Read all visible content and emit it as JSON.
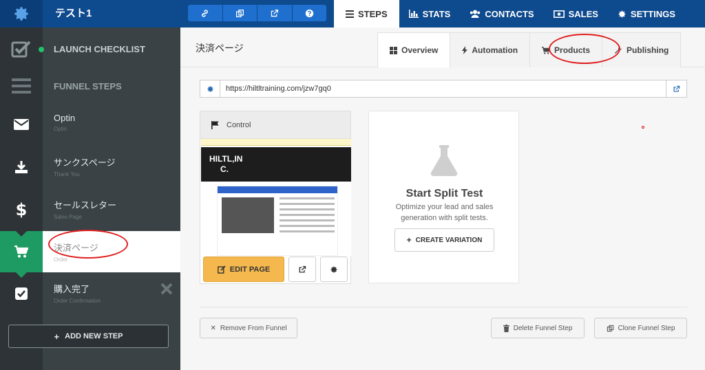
{
  "header": {
    "funnel_title": "テスト1",
    "nav": [
      {
        "label": "STEPS",
        "icon": "list-icon",
        "active": true
      },
      {
        "label": "STATS",
        "icon": "bar-chart-icon"
      },
      {
        "label": "CONTACTS",
        "icon": "users-icon"
      },
      {
        "label": "SALES",
        "icon": "money-icon"
      },
      {
        "label": "SETTINGS",
        "icon": "gear-icon"
      }
    ]
  },
  "sidebar": {
    "launch_checklist": "LAUNCH CHECKLIST",
    "funnel_steps_heading": "FUNNEL STEPS",
    "steps": [
      {
        "name": "Optin",
        "sub": "Optin",
        "icon": "envelope-icon"
      },
      {
        "name": "サンクスページ",
        "sub": "Thank You",
        "icon": "download-icon"
      },
      {
        "name": "セールスレター",
        "sub": "Sales Page",
        "icon": "dollar-icon"
      },
      {
        "name": "決済ページ",
        "sub": "Order",
        "icon": "cart-icon",
        "active": true
      },
      {
        "name": "購入完了",
        "sub": "Order Confirmation",
        "icon": "checkbox-icon"
      }
    ],
    "add_new_step": "ADD NEW STEP"
  },
  "main": {
    "page_title": "決済ページ",
    "tabs": [
      {
        "label": "Overview",
        "icon": "grid-icon",
        "active": true
      },
      {
        "label": "Automation",
        "icon": "bolt-icon"
      },
      {
        "label": "Products",
        "icon": "cart-icon"
      },
      {
        "label": "Publishing",
        "icon": "wrench-icon"
      }
    ],
    "url": "https://hiltltraining.com/jzw7gq0",
    "variant": {
      "label": "Control",
      "preview_brand_line1": "HILTL,IN",
      "preview_brand_line2": "C.",
      "edit_label": "EDIT PAGE"
    },
    "split_test": {
      "title": "Start Split Test",
      "description": "Optimize your lead and sales generation with split tests.",
      "create_label": "CREATE VARIATION"
    },
    "footer": {
      "remove_label": "Remove From Funnel",
      "delete_label": "Delete Funnel Step",
      "clone_label": "Clone Funnel Step"
    }
  },
  "colors": {
    "topbar": "#0e4a8e",
    "sidebar_dark": "#2d3336",
    "active_step": "#1e9b62",
    "edit_button": "#f5b84e",
    "annotation": "#e01e1e"
  }
}
